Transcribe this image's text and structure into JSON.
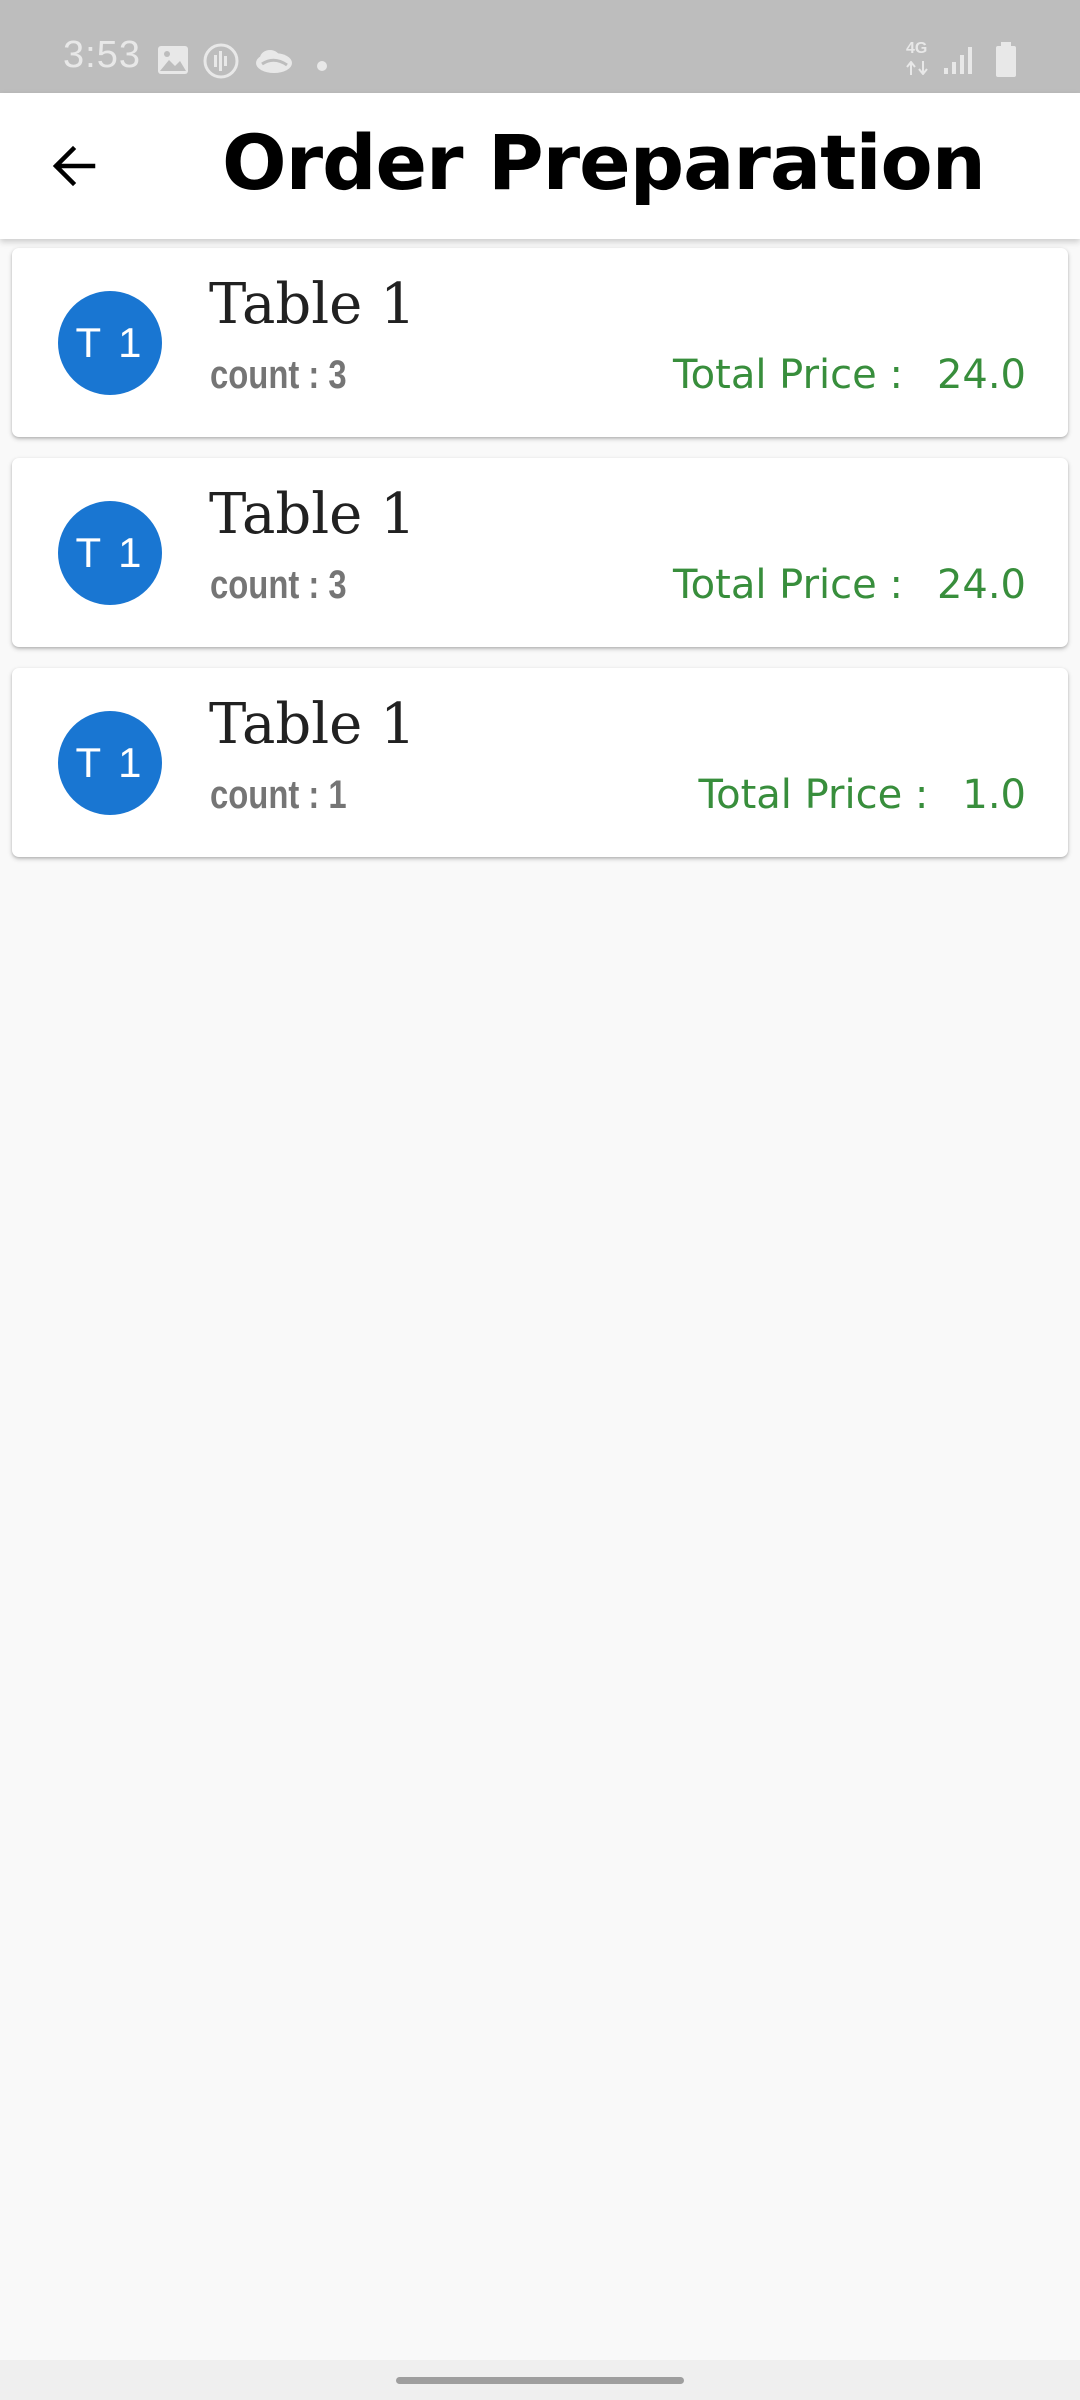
{
  "status_bar": {
    "time": "3:53",
    "network": "4G",
    "icons": [
      "gallery-icon",
      "voice-recorder-icon",
      "cloud-icon",
      "dot-icon",
      "network-4g-icon",
      "signal-icon",
      "battery-icon"
    ]
  },
  "app_bar": {
    "title": "Order Preparation",
    "back_icon": "arrow-back-icon"
  },
  "orders": [
    {
      "avatar": "T 1",
      "table": "Table 1",
      "count": "count : 3",
      "price_label": "Total Price :",
      "price": "24.0"
    },
    {
      "avatar": "T 1",
      "table": "Table 1",
      "count": "count : 3",
      "price_label": "Total Price :",
      "price": "24.0"
    },
    {
      "avatar": "T 1",
      "table": "Table 1",
      "count": "count : 1",
      "price_label": "Total Price :",
      "price": "1.0"
    }
  ],
  "colors": {
    "avatar": "#1976d2",
    "price": "#388e3c",
    "status_bar": "#bdbdbd",
    "background": "#f9f9f9"
  }
}
